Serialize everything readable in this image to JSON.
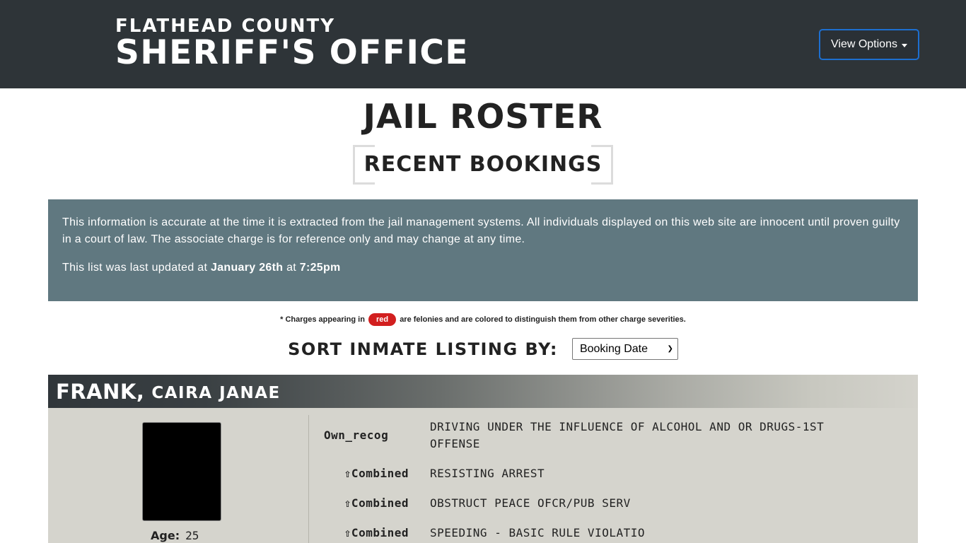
{
  "navbar": {
    "brand_line1": "FLATHEAD COUNTY",
    "brand_line2": "SHERIFF'S OFFICE",
    "options_label": "View Options"
  },
  "page": {
    "title": "JAIL ROSTER",
    "subtitle": "RECENT BOOKINGS"
  },
  "notice": {
    "paragraph1": "This information is accurate at the time it is extracted from the jail management systems. All individuals displayed on this web site are innocent until proven guilty in a court of law. The associate charge is for reference only and may change at any time.",
    "updated_prefix": "This list was last updated at",
    "updated_date": "January 26th",
    "updated_mid": "at",
    "updated_time": "7:25pm"
  },
  "legend": {
    "prefix": "* Charges appearing in",
    "badge": "red",
    "suffix": "are felonies and are colored to distinguish them from other charge severities."
  },
  "sort": {
    "label": "SORT INMATE LISTING BY:",
    "selected": "Booking Date"
  },
  "inmate": {
    "last_name": "FRANK,",
    "first_names": "CAIRA JANAE",
    "age_label": "Age:",
    "age": "25",
    "charges": [
      {
        "type": "Own_recog",
        "description": "DRIVING UNDER THE INFLUENCE OF ALCOHOL AND OR DRUGS-1ST OFFENSE"
      },
      {
        "type": "⇧Combined",
        "description": "RESISTING ARREST"
      },
      {
        "type": "⇧Combined",
        "description": "OBSTRUCT PEACE OFCR/PUB SERV"
      },
      {
        "type": "⇧Combined",
        "description": "SPEEDING - BASIC RULE VIOLATIO"
      }
    ]
  },
  "colors": {
    "navbar": "#2e3438",
    "notice_bg": "#607880",
    "felony_red": "#d21f1f",
    "card_bg": "#d5d4cd"
  },
  "icons": {
    "dropdown": "caret-down-icon"
  }
}
